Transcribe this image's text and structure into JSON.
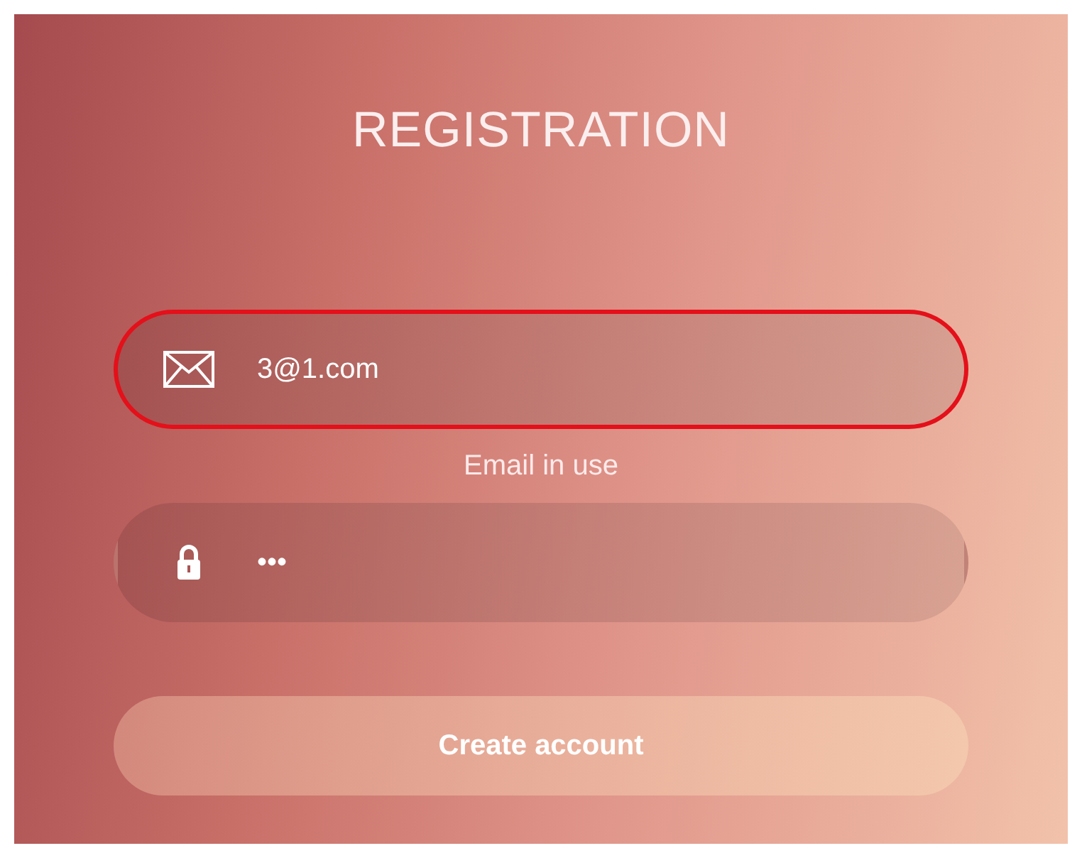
{
  "title": "REGISTRATION",
  "fields": [
    {
      "kind": "email",
      "value": "3@1.com",
      "error": true,
      "message": "Email in use"
    },
    {
      "kind": "password",
      "value": "•••",
      "error": false
    }
  ],
  "submit": {
    "label": "Create account"
  }
}
